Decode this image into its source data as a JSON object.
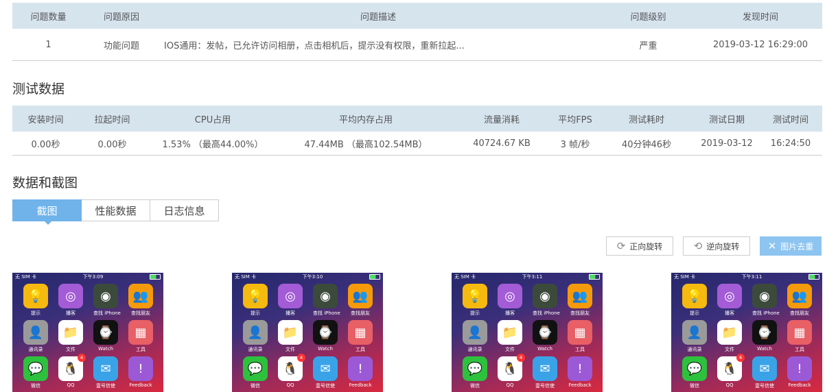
{
  "issues": {
    "headers": [
      "问题数量",
      "问题原因",
      "问题描述",
      "问题级别",
      "发现时间"
    ],
    "rows": [
      [
        "1",
        "功能问题",
        "IOS通用：发帖，已允许访问相册，点击相机后，提示没有权限，重新拉起...",
        "严重",
        "2019-03-12 16:29:00"
      ]
    ]
  },
  "test_section": {
    "title": "测试数据"
  },
  "test": {
    "headers": [
      "安装时间",
      "拉起时间",
      "CPU占用",
      "平均内存占用",
      "流量消耗",
      "平均FPS",
      "测试耗时",
      "测试日期",
      "测试时间"
    ],
    "rows": [
      [
        "0.00秒",
        "0.00秒",
        "1.53%  （最高44.00%）",
        "47.44MB  （最高102.54MB）",
        "40724.67 KB",
        "3 帧/秒",
        "40分钟46秒",
        "2019-03-12",
        "16:24:50"
      ]
    ]
  },
  "data_section": {
    "title": "数据和截图"
  },
  "tabs": [
    "截图",
    "性能数据",
    "日志信息"
  ],
  "buttons": {
    "rotate_cw": "正向旋转",
    "rotate_ccw": "逆向旋转",
    "dedupe": "图片去重"
  },
  "screenshots": [
    {
      "carrier": "无 SIM 卡",
      "time": "下午3:09"
    },
    {
      "carrier": "无 SIM 卡",
      "time": "下午3:10"
    },
    {
      "carrier": "无 SIM 卡",
      "time": "下午3:11"
    },
    {
      "carrier": "无 SIM 卡",
      "time": "下午3:11"
    }
  ],
  "apps": [
    {
      "label": "提示",
      "icon": "tips-icon",
      "color": "#f5b90f",
      "glyph": "💡"
    },
    {
      "label": "播客",
      "icon": "podcasts-icon",
      "color": "#a35bd6",
      "glyph": "◎"
    },
    {
      "label": "查找 iPhone",
      "icon": "find-iphone-icon",
      "color": "#3c4a3c",
      "glyph": "◉"
    },
    {
      "label": "查找朋友",
      "icon": "find-friends-icon",
      "color": "#f59a0b",
      "glyph": "👥"
    },
    {
      "label": "通讯录",
      "icon": "contacts-icon",
      "color": "#9a9a9a",
      "glyph": "👤"
    },
    {
      "label": "文件",
      "icon": "files-icon",
      "color": "#ffffff",
      "glyph": "📁"
    },
    {
      "label": "Watch",
      "icon": "watch-icon",
      "color": "#111111",
      "glyph": "⌚"
    },
    {
      "label": "工具",
      "icon": "tools-icon",
      "color": "#e85f66",
      "glyph": "▦"
    },
    {
      "label": "微信",
      "icon": "wechat-icon",
      "color": "#2dc13d",
      "glyph": "💬"
    },
    {
      "label": "QQ",
      "icon": "qq-icon",
      "color": "#ffffff",
      "glyph": "🐧",
      "badge": "4"
    },
    {
      "label": "壹号信使",
      "icon": "messenger-icon",
      "color": "#3aa3e8",
      "glyph": "✉"
    },
    {
      "label": "Feedback",
      "icon": "feedback-icon",
      "color": "#9b59d6",
      "glyph": "!"
    }
  ]
}
